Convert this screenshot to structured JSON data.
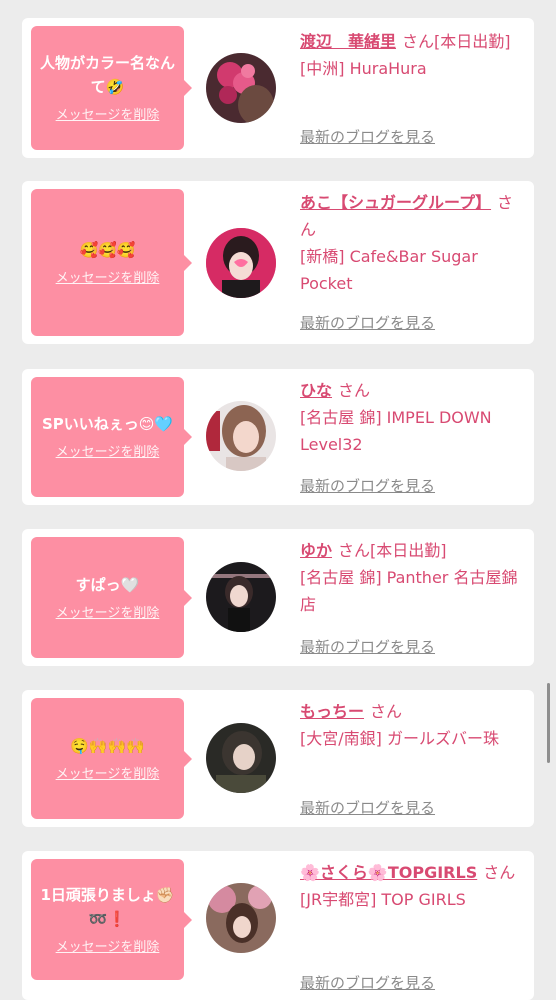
{
  "cards": [
    {
      "message": "人物がカラー名なんて🤣",
      "delete_label": "メッセージを削除",
      "name": "渡辺　華緒里",
      "suffix": "さん",
      "status": "[本日出勤]",
      "shop": "[中洲] HuraHura",
      "blog_label": "最新のブログを見る"
    },
    {
      "message": "🥰🥰🥰",
      "delete_label": "メッセージを削除",
      "name": "あこ【シュガーグループ】",
      "suffix": "さん",
      "status": "",
      "shop": "[新橋] Cafe&Bar Sugar Pocket",
      "blog_label": "最新のブログを見る"
    },
    {
      "message": "SPいいねぇっ😊🩵",
      "delete_label": "メッセージを削除",
      "name": "ひな",
      "suffix": "さん",
      "status": "",
      "shop": "[名古屋 錦] IMPEL DOWN Level32",
      "blog_label": "最新のブログを見る"
    },
    {
      "message": "すぱっ🤍",
      "delete_label": "メッセージを削除",
      "name": "ゆか",
      "suffix": "さん",
      "status": "[本日出勤]",
      "shop": "[名古屋 錦] Panther 名古屋錦店",
      "blog_label": "最新のブログを見る"
    },
    {
      "message": "🤤🙌🙌🙌",
      "delete_label": "メッセージを削除",
      "name": "もっちー",
      "suffix": "さん",
      "status": "",
      "shop": "[大宮/南銀] ガールズバー珠",
      "blog_label": "最新のブログを見る"
    },
    {
      "message": "1日頑張りましょ✊🏻➿❗️",
      "delete_label": "メッセージを削除",
      "name": "🌸さくら🌸TOPGIRLS",
      "suffix": "さん",
      "status": "",
      "shop": "[JR宇都宮] TOP GIRLS",
      "blog_label": "最新のブログを見る"
    }
  ],
  "colors": {
    "page_bg": "#ececec",
    "bubble": "#fd8fa3",
    "accent_text": "#d84a72",
    "link_gray": "#8a8a8a"
  }
}
